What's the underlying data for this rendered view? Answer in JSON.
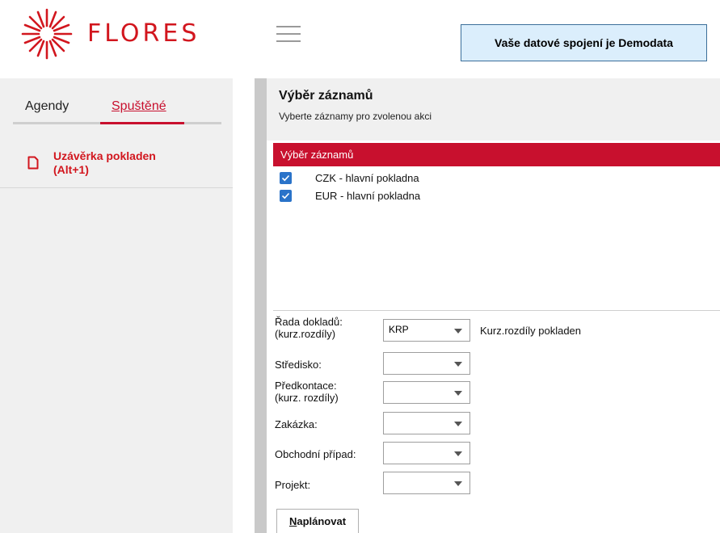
{
  "header": {
    "brand": "FLORES",
    "connection_text": "Vaše datové spojení je Demodata"
  },
  "sidebar": {
    "tabs": [
      {
        "label": "Agendy"
      },
      {
        "label": "Spuštěné",
        "active": true
      }
    ],
    "items": [
      {
        "label": "Uzávěrka pokladen\n(Alt+1)",
        "icon": "document-icon"
      }
    ]
  },
  "main": {
    "title": "Výběr záznamů",
    "subtitle": "Vyberte záznamy pro zvolenou akci",
    "grid": {
      "header": "Výběr záznamů",
      "rows": [
        {
          "label": "CZK - hlavní pokladna",
          "checked": true
        },
        {
          "label": "EUR - hlavní pokladna",
          "checked": true
        }
      ]
    },
    "form": {
      "rada": {
        "label": "Řada dokladů:\n(kurz.rozdíly)",
        "value": "KRP",
        "desc": "Kurz.rozdíly pokladen"
      },
      "stredisko": {
        "label": "Středisko:",
        "value": ""
      },
      "predkontace": {
        "label": "Předkontace:\n(kurz. rozdíly)",
        "value": ""
      },
      "zakazka": {
        "label": "Zakázka:",
        "value": ""
      },
      "obchodni_pripad": {
        "label": "Obchodní případ:",
        "value": ""
      },
      "projekt": {
        "label": "Projekt:",
        "value": ""
      }
    },
    "plan_button": {
      "first": "N",
      "rest": "aplánovat"
    }
  },
  "colors": {
    "brand_red": "#d2161e",
    "accent_red": "#c8102e",
    "checkbox_blue": "#2a73c9",
    "info_box_bg": "#dbeefc"
  }
}
